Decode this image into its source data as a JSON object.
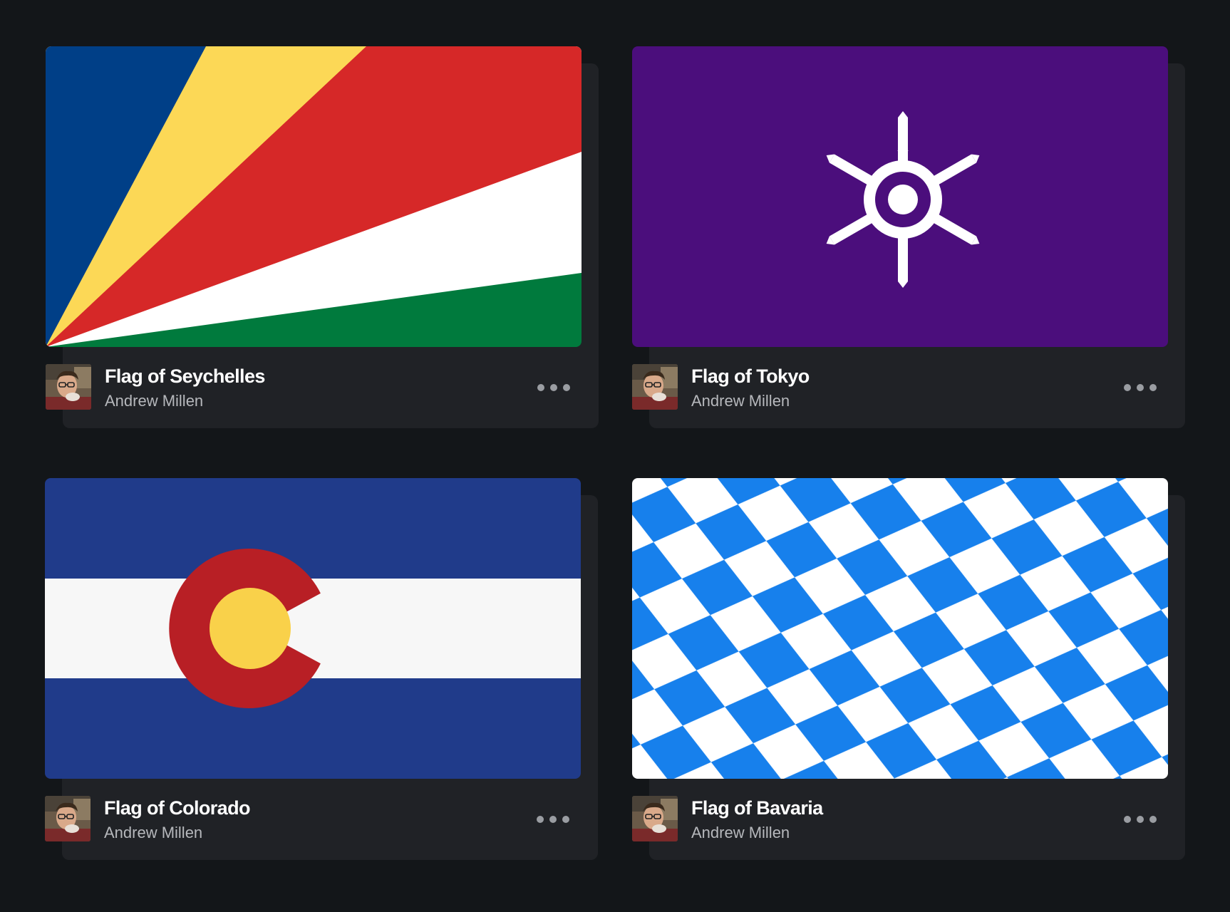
{
  "cards": [
    {
      "title": "Flag of Seychelles",
      "author": "Andrew Millen",
      "thumbnail_icon": "seychelles-flag",
      "more_icon": "more-horizontal-icon"
    },
    {
      "title": "Flag of Tokyo",
      "author": "Andrew Millen",
      "thumbnail_icon": "tokyo-flag",
      "more_icon": "more-horizontal-icon"
    },
    {
      "title": "Flag of Colorado",
      "author": "Andrew Millen",
      "thumbnail_icon": "colorado-flag",
      "more_icon": "more-horizontal-icon"
    },
    {
      "title": "Flag of Bavaria",
      "author": "Andrew Millen",
      "thumbnail_icon": "bavaria-flag",
      "more_icon": "more-horizontal-icon"
    }
  ],
  "colors": {
    "page_background": "#131619",
    "card_background": "#202226",
    "title_text": "#ffffff",
    "author_text": "#b6b8bc",
    "seychelles_blue": "#003F87",
    "seychelles_yellow": "#FCD856",
    "seychelles_red": "#D62828",
    "seychelles_white": "#FFFFFF",
    "seychelles_green": "#007A3D",
    "tokyo_purple": "#4B0E7C",
    "colorado_blue": "#203B8A",
    "colorado_red": "#B81F25",
    "colorado_gold": "#F9D14A",
    "bavaria_blue": "#1780EC"
  }
}
